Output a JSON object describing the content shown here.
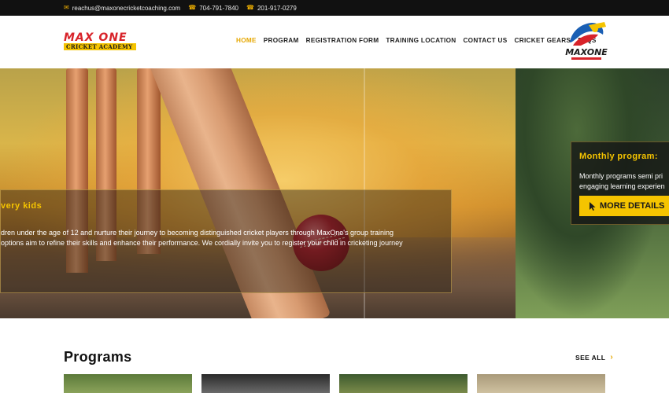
{
  "topbar": {
    "email": "reachus@maxonecricketcoaching.com",
    "phone1": "704-791-7840",
    "phone2": "201-917-0279",
    "icons": [
      "mail-icon",
      "phone-icon",
      "phone-icon"
    ]
  },
  "header": {
    "logo": {
      "top": "MAX ONE",
      "bottom": "CRICKET ACADEMY"
    },
    "badge_text": "MAXONE",
    "nav": [
      {
        "label": "HOME",
        "active": true
      },
      {
        "label": "PROGRAM",
        "active": false
      },
      {
        "label": "REGISTRATION FORM",
        "active": false
      },
      {
        "label": "TRAINING LOCATION",
        "active": false
      },
      {
        "label": "CONTACT US",
        "active": false
      },
      {
        "label": "CRICKET GEARS",
        "active": false
      },
      {
        "label": "FAQS",
        "active": false
      }
    ]
  },
  "hero": {
    "slide1": {
      "title": "very kids",
      "line1": "dren under the age of 12 and nurture their journey to becoming distinguished cricket players through MaxOne's group training",
      "line2": "options aim to refine their skills and enhance their performance. We cordially invite you to register your child in cricketing journey"
    },
    "slide2": {
      "title": "Monthly program:",
      "line1": "Monthly programs semi pri",
      "line2": "engaging learning experien",
      "button": "MORE DETAILS"
    }
  },
  "programs": {
    "title": "Programs",
    "see_all": "SEE ALL"
  },
  "colors": {
    "accent": "#f5c400",
    "nav_active": "#e6a700",
    "topbar": "#111111",
    "logo_red": "#d8232a"
  }
}
